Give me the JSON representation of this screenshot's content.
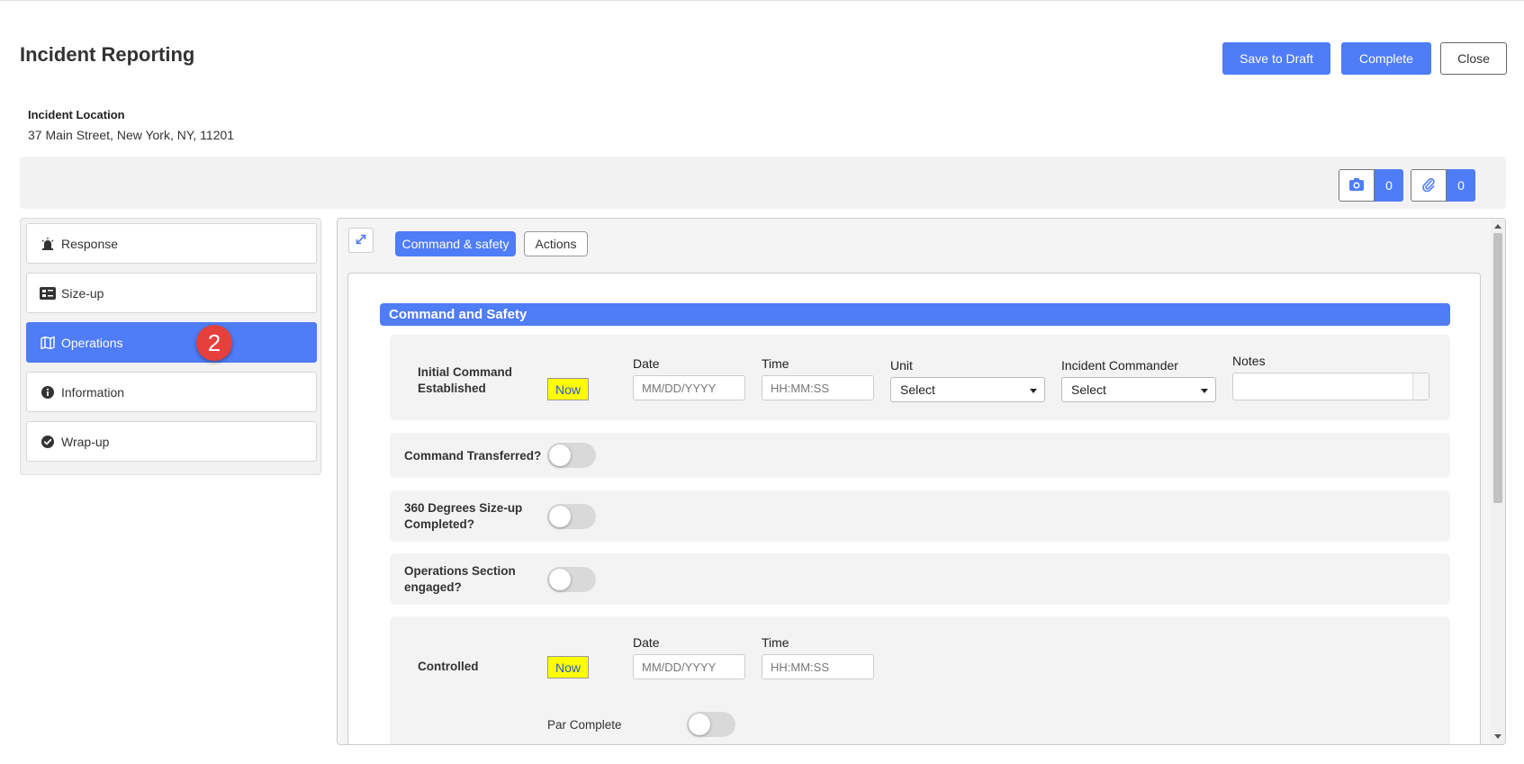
{
  "header": {
    "title": "Incident Reporting",
    "save_draft_label": "Save to Draft",
    "complete_label": "Complete",
    "close_label": "Close"
  },
  "location": {
    "label": "Incident Location",
    "value": "37 Main Street, New York, NY, 11201"
  },
  "toolbar": {
    "photo_count": "0",
    "attachment_count": "0"
  },
  "sidebar": {
    "items": [
      {
        "label": "Response",
        "icon": "siren-icon"
      },
      {
        "label": "Size-up",
        "icon": "dashboard-icon"
      },
      {
        "label": "Operations",
        "icon": "map-icon",
        "active": true
      },
      {
        "label": "Information",
        "icon": "info-icon"
      },
      {
        "label": "Wrap-up",
        "icon": "check-circle-icon"
      }
    ],
    "badge": "2"
  },
  "tabs": {
    "command_safety": "Command & safety",
    "actions": "Actions"
  },
  "section": {
    "title": "Command and Safety",
    "initial_command": {
      "label": "Initial Command Established",
      "now": "Now",
      "date_label": "Date",
      "date_placeholder": "MM/DD/YYYY",
      "time_label": "Time",
      "time_placeholder": "HH:MM:SS",
      "unit_label": "Unit",
      "unit_value": "Select",
      "commander_label": "Incident Commander",
      "commander_value": "Select",
      "notes_label": "Notes"
    },
    "command_transferred": "Command Transferred?",
    "size_up_completed": "360 Degrees Size-up Completed?",
    "operations_engaged": "Operations Section engaged?",
    "controlled": {
      "label": "Controlled",
      "now": "Now",
      "date_label": "Date",
      "date_placeholder": "MM/DD/YYYY",
      "time_label": "Time",
      "time_placeholder": "HH:MM:SS",
      "par_label": "Par Complete"
    }
  },
  "colors": {
    "primary": "#4f7cf7",
    "badge": "#e5403b",
    "now_button": "#ffff00"
  }
}
